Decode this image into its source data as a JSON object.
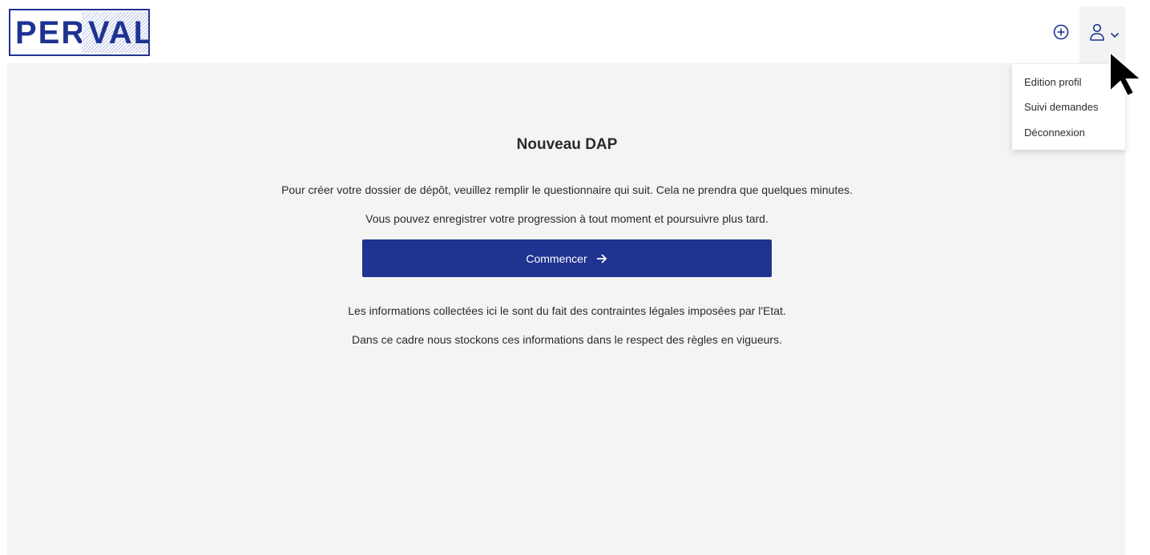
{
  "header": {
    "logo_text": "PER",
    "logo_text_highlight": "VAL",
    "add_icon": "plus-circle-icon",
    "user_icon": "user-icon",
    "chevron_icon": "chevron-down-icon"
  },
  "user_menu": {
    "items": [
      {
        "label": "Edition profil"
      },
      {
        "label": "Suivi demandes"
      },
      {
        "label": "Déconnexion"
      }
    ]
  },
  "main": {
    "title": "Nouveau DAP",
    "intro_1": "Pour créer votre dossier de dépôt, veuillez remplir le questionnaire qui suit. Cela ne prendra que quelques minutes.",
    "intro_2": "Vous pouvez enregistrer votre progression à tout moment et poursuivre plus tard.",
    "start_button": "Commencer",
    "start_icon": "arrow-right-icon",
    "legal_1": "Les informations collectées ici le sont du fait des contraintes légales imposées par l'Etat.",
    "legal_2": "Dans ce cadre nous stockons ces informations dans le respect des règles en vigueurs."
  },
  "colors": {
    "brand": "#1e3391",
    "button": "#1f3390",
    "background": "#f4f4f4"
  }
}
